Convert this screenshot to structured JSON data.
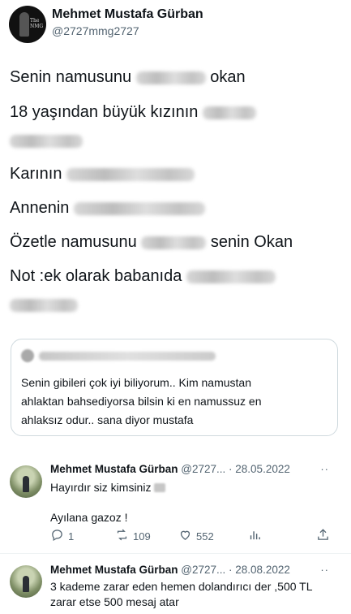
{
  "main_tweet": {
    "name": "Mehmet Mustafa Gürban",
    "handle": "@2727mmg2727",
    "avatar_text": "The NMG",
    "lines": [
      {
        "before": "Senin namusunu",
        "after": "okan"
      },
      {
        "before": "18 yaşından büyük kızının",
        "after": ""
      },
      {
        "before": "",
        "after": ""
      },
      {
        "before": "Karının",
        "after": ""
      },
      {
        "before": "Annenin",
        "after": ""
      },
      {
        "before": "Özetle namusunu",
        "after": "senin Okan"
      },
      {
        "before": "Not :ek olarak babanıda",
        "after": ""
      },
      {
        "before": "",
        "after": ""
      }
    ]
  },
  "quote": {
    "lines": [
      "Senin gibileri çok iyi biliyorum.. Kim namustan",
      "ahlaktan bahsediyorsa bilsin ki en namussuz en",
      "ahlaksız odur.. sana diyor mustafa"
    ]
  },
  "replies": [
    {
      "name": "Mehmet Mustafa Gürban",
      "handle_date": "@2727... · 28.05.2022",
      "more": "··",
      "text1": "Hayırdır siz kimsiniz",
      "text2": "Ayılana gazoz !"
    },
    {
      "name": "Mehmet Mustafa Gürban",
      "handle_date": "@2727... · 28.08.2022",
      "more": "··",
      "text1": "3 kademe zarar eden hemen dolandırıcı der ,500 TL",
      "text2": "zarar etse 500 mesaj atar"
    }
  ],
  "actions": {
    "replies": "1",
    "retweets": "109",
    "likes": "552",
    "icons": [
      "reply-icon",
      "retweet-icon",
      "like-icon",
      "analytics-icon",
      "share-icon"
    ]
  }
}
